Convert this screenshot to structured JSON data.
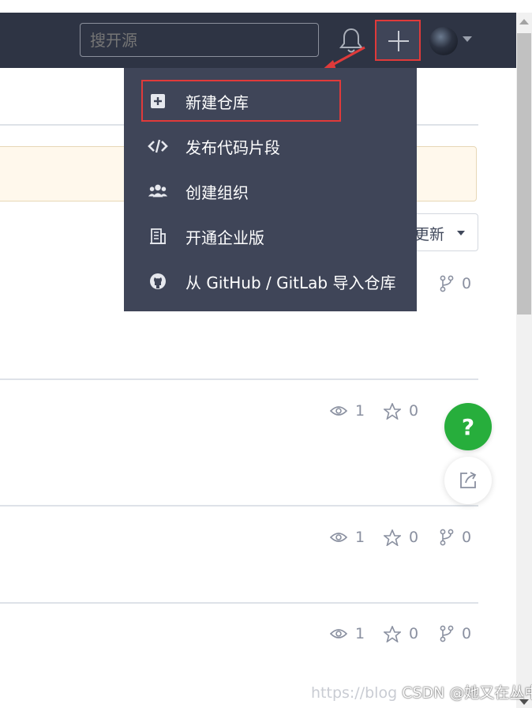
{
  "header": {
    "search_placeholder": "搜开源",
    "icons": {
      "bell": "bell-icon",
      "plus": "plus-icon",
      "avatar": "avatar",
      "caret": "caret-down-icon"
    }
  },
  "create_menu": {
    "items": [
      {
        "label": "新建仓库",
        "icon": "plus-square-icon"
      },
      {
        "label": "发布代码片段",
        "icon": "code-icon"
      },
      {
        "label": "创建组织",
        "icon": "users-icon"
      },
      {
        "label": "开通企业版",
        "icon": "building-icon"
      },
      {
        "label": "从 GitHub / GitLab 导入仓库",
        "icon": "github-icon"
      }
    ]
  },
  "repo_list": {
    "sort_label": "更新",
    "rows": [
      {
        "watches": "",
        "stars": "",
        "forks": "0"
      },
      {
        "watches": "1",
        "stars": "0",
        "forks": ""
      },
      {
        "watches": "1",
        "stars": "0",
        "forks": "0"
      },
      {
        "watches": "1",
        "stars": "0",
        "forks": "0"
      }
    ]
  },
  "floating": {
    "help": "?",
    "share_icon": "share-icon"
  },
  "watermark": {
    "url": "https://blog",
    "author": "CSDN @她又在丛中笑"
  },
  "colors": {
    "navbar": "#2e3444",
    "menu": "#3f4558",
    "highlight": "#e03a3a",
    "help": "#27ae3c"
  }
}
